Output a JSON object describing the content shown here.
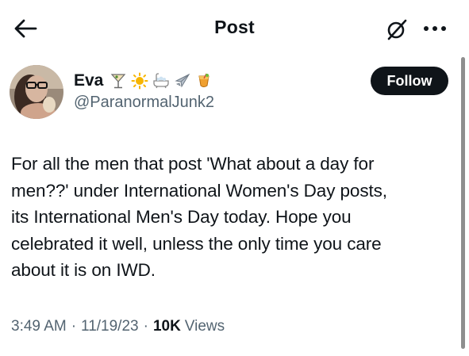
{
  "header": {
    "title": "Post",
    "back_icon": "arrow-left-icon",
    "grok_icon": "grok-icon",
    "more_icon": "more-dots-icon"
  },
  "author": {
    "display_name": "Eva",
    "handle": "@ParanormalJunk2",
    "emojis": [
      "cocktail",
      "sun",
      "bathtub",
      "airplane",
      "tropical-drink"
    ]
  },
  "follow": {
    "label": "Follow"
  },
  "post": {
    "lines": [
      "For all the men that post 'What about a day for",
      "men??' under International Women's Day posts,",
      "its International Men's Day today. Hope you",
      "celebrated it well, unless the only time you care",
      "about it is on IWD."
    ]
  },
  "meta": {
    "time": "3:49 AM",
    "date": "11/19/23",
    "separator": "·",
    "views_count": "10K",
    "views_label": "Views"
  },
  "colors": {
    "text_primary": "#0f1419",
    "text_secondary": "#536471",
    "follow_bg": "#0f1419",
    "follow_text": "#ffffff",
    "scrollbar": "#8e8e8e"
  }
}
